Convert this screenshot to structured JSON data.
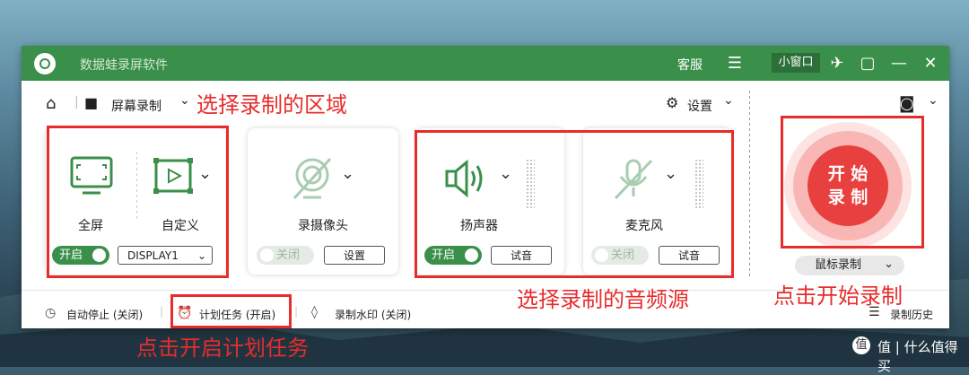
{
  "app": {
    "title": "数据蛙录屏软件"
  },
  "titlebar": {
    "service": "客服",
    "mini_window": "小窗口"
  },
  "nav": {
    "mode_label": "屏幕录制",
    "settings_label": "设置"
  },
  "cards": {
    "screen": {
      "fullscreen_label": "全屏",
      "custom_label": "自定义",
      "toggle_label": "开启",
      "display_value": "DISPLAY1"
    },
    "camera": {
      "label": "录摄像头",
      "toggle_label": "关闭",
      "settings_btn": "设置"
    },
    "speaker": {
      "label": "扬声器",
      "toggle_label": "开启",
      "test_btn": "试音"
    },
    "mic": {
      "label": "麦克风",
      "toggle_label": "关闭",
      "test_btn": "试音"
    }
  },
  "record": {
    "line1": "开 始",
    "line2": "录 制",
    "mode_label": "鼠标录制"
  },
  "bottom": {
    "auto_stop": "自动停止 (关闭)",
    "schedule": "计划任务 (开启)",
    "watermark": "录制水印 (关闭)",
    "history": "录制历史"
  },
  "annotations": {
    "select_area": "选择录制的区域",
    "select_audio": "选择录制的音频源",
    "click_start": "点击开始录制",
    "schedule_tip": "点击开启计划任务"
  },
  "watermark": {
    "text": "值 | 什么值得买"
  },
  "colors": {
    "brand_green": "#3a8f4a",
    "record_red": "#e8403f",
    "annotation_red": "#e82c2c"
  }
}
